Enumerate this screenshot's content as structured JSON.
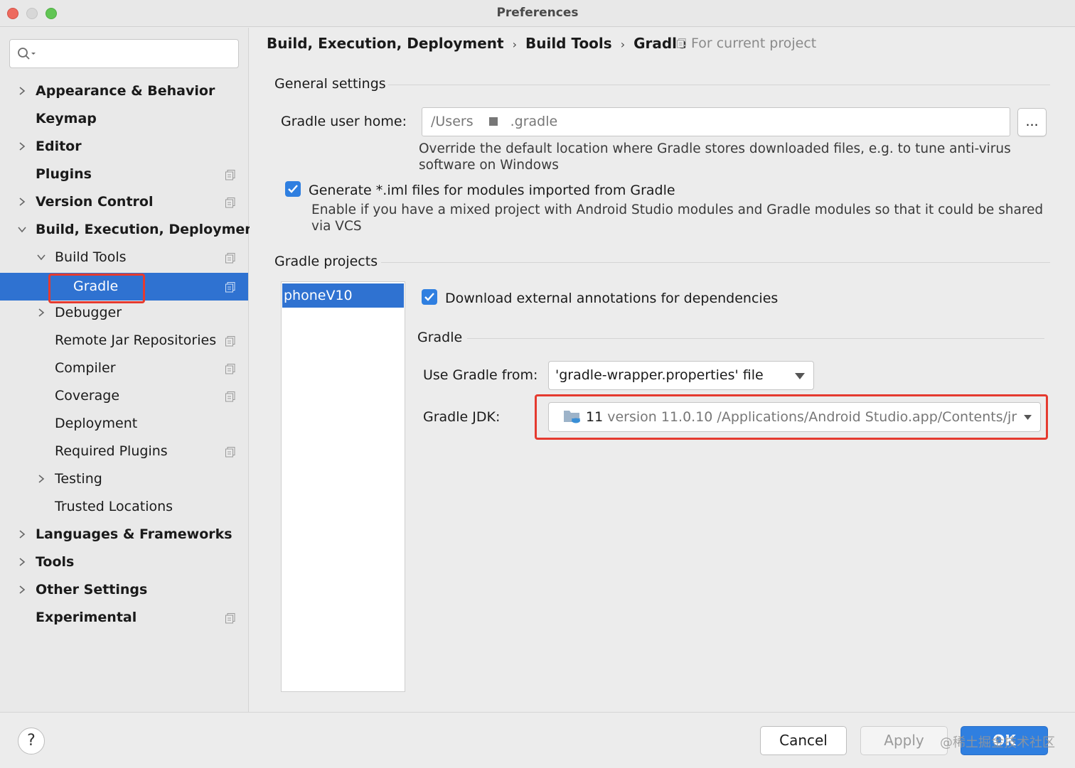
{
  "window": {
    "title": "Preferences"
  },
  "sidebar": {
    "search_placeholder": "",
    "items": [
      {
        "label": "Appearance & Behavior"
      },
      {
        "label": "Keymap"
      },
      {
        "label": "Editor"
      },
      {
        "label": "Plugins"
      },
      {
        "label": "Version Control"
      },
      {
        "label": "Build, Execution, Deployment"
      },
      {
        "label": "Build Tools"
      },
      {
        "label": "Gradle"
      },
      {
        "label": "Debugger"
      },
      {
        "label": "Remote Jar Repositories"
      },
      {
        "label": "Compiler"
      },
      {
        "label": "Coverage"
      },
      {
        "label": "Deployment"
      },
      {
        "label": "Required Plugins"
      },
      {
        "label": "Testing"
      },
      {
        "label": "Trusted Locations"
      },
      {
        "label": "Languages & Frameworks"
      },
      {
        "label": "Tools"
      },
      {
        "label": "Other Settings"
      },
      {
        "label": "Experimental"
      }
    ]
  },
  "breadcrumb": [
    "Build, Execution, Deployment",
    "Build Tools",
    "Gradle"
  ],
  "scope_label": "For current project",
  "general": {
    "title": "General settings",
    "user_home_label": "Gradle user home:",
    "user_home_value_start": "/Users",
    "user_home_value_end": ".gradle",
    "browse_label": "...",
    "user_home_hint_1": "Override the default location where Gradle stores downloaded files, e.g. to tune anti-virus",
    "user_home_hint_2": "software on Windows",
    "iml_checkbox_label": "Generate *.iml files for modules imported from Gradle",
    "iml_checked": true,
    "iml_hint_1": "Enable if you have a mixed project with Android Studio modules and Gradle modules so that it could be shared",
    "iml_hint_2": "via VCS"
  },
  "projects": {
    "title": "Gradle projects",
    "list": [
      "phoneV10"
    ],
    "download_annotations_label": "Download external annotations for dependencies",
    "download_annotations_checked": true,
    "gradle_section_title": "Gradle",
    "use_gradle_from_label": "Use Gradle from:",
    "use_gradle_from_value": "'gradle-wrapper.properties' file",
    "gradle_jdk_label": "Gradle JDK:",
    "gradle_jdk_version": "11",
    "gradle_jdk_detail": "version 11.0.10 /Applications/Android Studio.app/Contents/jr"
  },
  "footer": {
    "help_label": "?",
    "cancel_label": "Cancel",
    "apply_label": "Apply",
    "ok_label": "OK",
    "watermark": "@稀土掘金技术社区"
  },
  "colors": {
    "selection": "#2f72d1",
    "highlight_box": "#e53a2f",
    "checkbox": "#2f7fe0"
  }
}
